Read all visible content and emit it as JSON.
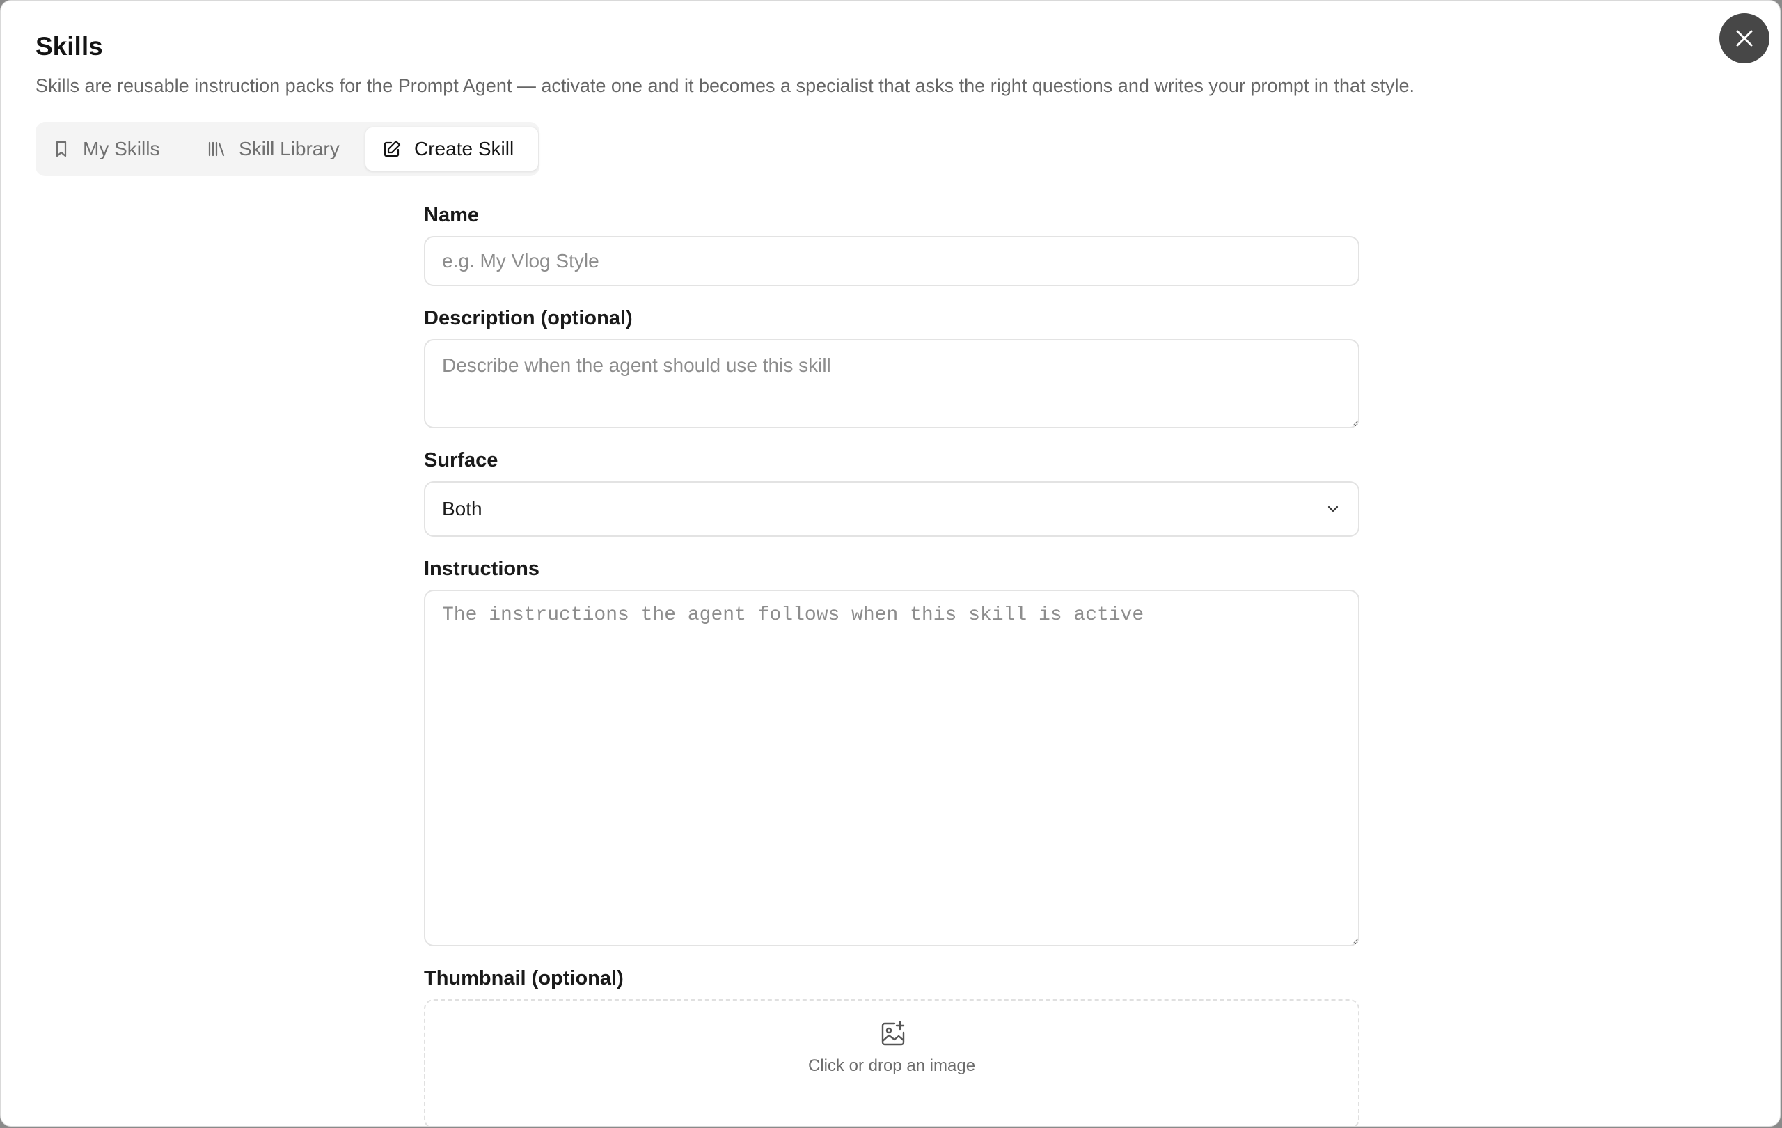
{
  "header": {
    "title": "Skills",
    "subtitle": "Skills are reusable instruction packs for the Prompt Agent — activate one and it becomes a specialist that asks the right questions and writes your prompt in that style."
  },
  "tabs": [
    {
      "label": "My Skills",
      "icon": "bookmark-icon",
      "active": false
    },
    {
      "label": "Skill Library",
      "icon": "library-icon",
      "active": false
    },
    {
      "label": "Create Skill",
      "icon": "edit-icon",
      "active": true
    }
  ],
  "form": {
    "name": {
      "label": "Name",
      "placeholder": "e.g. My Vlog Style",
      "value": ""
    },
    "description": {
      "label": "Description (optional)",
      "placeholder": "Describe when the agent should use this skill",
      "value": ""
    },
    "surface": {
      "label": "Surface",
      "value": "Both"
    },
    "instructions": {
      "label": "Instructions",
      "placeholder": "The instructions the agent follows when this skill is active",
      "value": ""
    },
    "thumbnail": {
      "label": "Thumbnail (optional)",
      "drop_text": "Click or drop an image",
      "icon": "image-add-icon"
    }
  },
  "colors": {
    "close_button": "#474747",
    "active_tab_bg": "#ffffff",
    "tabs_bg": "#f4f4f4"
  }
}
